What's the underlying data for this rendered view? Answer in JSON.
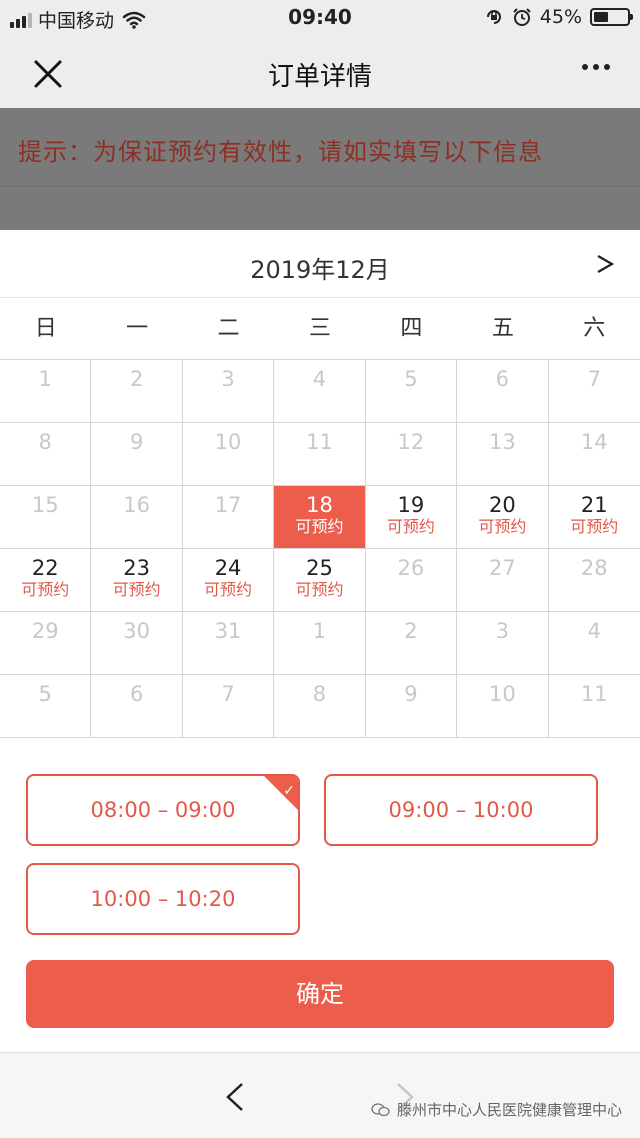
{
  "status_bar": {
    "carrier": "中国移动",
    "time": "09:40",
    "battery": "45%",
    "battery_level": 0.45
  },
  "nav": {
    "title": "订单详情"
  },
  "notice": "提示：为保证预约有效性，请如实填写以下信息",
  "calendar": {
    "month_title": "2019年12月",
    "next_label": ">",
    "weekdays": [
      "日",
      "一",
      "二",
      "三",
      "四",
      "五",
      "六"
    ],
    "days": [
      {
        "num": "1",
        "sub": ""
      },
      {
        "num": "2",
        "sub": ""
      },
      {
        "num": "3",
        "sub": ""
      },
      {
        "num": "4",
        "sub": ""
      },
      {
        "num": "5",
        "sub": ""
      },
      {
        "num": "6",
        "sub": ""
      },
      {
        "num": "7",
        "sub": ""
      },
      {
        "num": "8",
        "sub": ""
      },
      {
        "num": "9",
        "sub": ""
      },
      {
        "num": "10",
        "sub": ""
      },
      {
        "num": "11",
        "sub": ""
      },
      {
        "num": "12",
        "sub": ""
      },
      {
        "num": "13",
        "sub": ""
      },
      {
        "num": "14",
        "sub": ""
      },
      {
        "num": "15",
        "sub": ""
      },
      {
        "num": "16",
        "sub": ""
      },
      {
        "num": "17",
        "sub": ""
      },
      {
        "num": "18",
        "sub": "可预约"
      },
      {
        "num": "19",
        "sub": "可预约"
      },
      {
        "num": "20",
        "sub": "可预约"
      },
      {
        "num": "21",
        "sub": "可预约"
      },
      {
        "num": "22",
        "sub": "可预约"
      },
      {
        "num": "23",
        "sub": "可预约"
      },
      {
        "num": "24",
        "sub": "可预约"
      },
      {
        "num": "25",
        "sub": "可预约"
      },
      {
        "num": "26",
        "sub": ""
      },
      {
        "num": "27",
        "sub": ""
      },
      {
        "num": "28",
        "sub": ""
      },
      {
        "num": "29",
        "sub": ""
      },
      {
        "num": "30",
        "sub": ""
      },
      {
        "num": "31",
        "sub": ""
      },
      {
        "num": "1",
        "sub": ""
      },
      {
        "num": "2",
        "sub": ""
      },
      {
        "num": "3",
        "sub": ""
      },
      {
        "num": "4",
        "sub": ""
      },
      {
        "num": "5",
        "sub": ""
      },
      {
        "num": "6",
        "sub": ""
      },
      {
        "num": "7",
        "sub": ""
      },
      {
        "num": "8",
        "sub": ""
      },
      {
        "num": "9",
        "sub": ""
      },
      {
        "num": "10",
        "sub": ""
      },
      {
        "num": "11",
        "sub": ""
      }
    ],
    "selected_day": "18",
    "accent_color": "#ec5d4c"
  },
  "time_slots": [
    {
      "label": "08:00 – 09:00",
      "selected": true
    },
    {
      "label": "09:00 – 10:00",
      "selected": false
    },
    {
      "label": "10:00 – 10:20",
      "selected": false
    }
  ],
  "confirm_label": "确定",
  "watermark": "滕州市中心人民医院健康管理中心"
}
